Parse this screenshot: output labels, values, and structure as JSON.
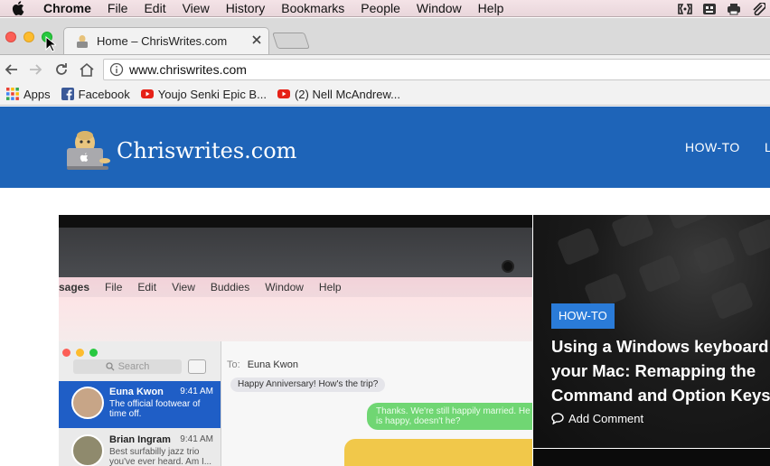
{
  "menubar": {
    "app": "Chrome",
    "items": [
      "File",
      "Edit",
      "View",
      "History",
      "Bookmarks",
      "People",
      "Window",
      "Help"
    ],
    "tray_icons": [
      "bluetooth-like-icon",
      "contacts-icon",
      "printer-icon",
      "attachment-icon"
    ]
  },
  "tab": {
    "title": "Home – ChrisWrites.com"
  },
  "toolbar": {
    "url": "www.chriswrites.com"
  },
  "bookmarks": [
    {
      "label": "Apps",
      "icon": "apps-grid-icon"
    },
    {
      "label": "Facebook",
      "icon": "facebook-icon"
    },
    {
      "label": "Youjo Senki Epic B...",
      "icon": "youtube-icon"
    },
    {
      "label": "(2) Nell McAndrew...",
      "icon": "youtube-icon"
    }
  ],
  "site": {
    "name": "Chriswrites.com",
    "nav": [
      "HOW-TO",
      "L"
    ]
  },
  "hero": {
    "screenshot": {
      "menu": [
        "sages",
        "File",
        "Edit",
        "View",
        "Buddies",
        "Window",
        "Help"
      ],
      "search_placeholder": "Search",
      "to_label": "To:",
      "to_value": "Euna Kwon",
      "conversations": [
        {
          "name": "Euna Kwon",
          "time": "9:41 AM",
          "snippet": "The official footwear of time off."
        },
        {
          "name": "Brian Ingram",
          "time": "9:41 AM",
          "snippet": "Best surfabilly jazz trio you've ever heard. Am I..."
        }
      ],
      "bubble_in": "Happy Anniversary! How's the trip?",
      "bubble_out": "Thanks. We're still happily married. He is happy, doesn't he?"
    },
    "badge": "HOW-TO",
    "title_lines": [
      "Using a Windows keyboard o",
      "your Mac: Remapping the",
      "Command and Option Keys"
    ],
    "comment": "Add Comment"
  },
  "colors": {
    "site_blue": "#1e64b8",
    "badge_blue": "#2a7bd8",
    "menubar_pink": "#f4e3e7"
  }
}
